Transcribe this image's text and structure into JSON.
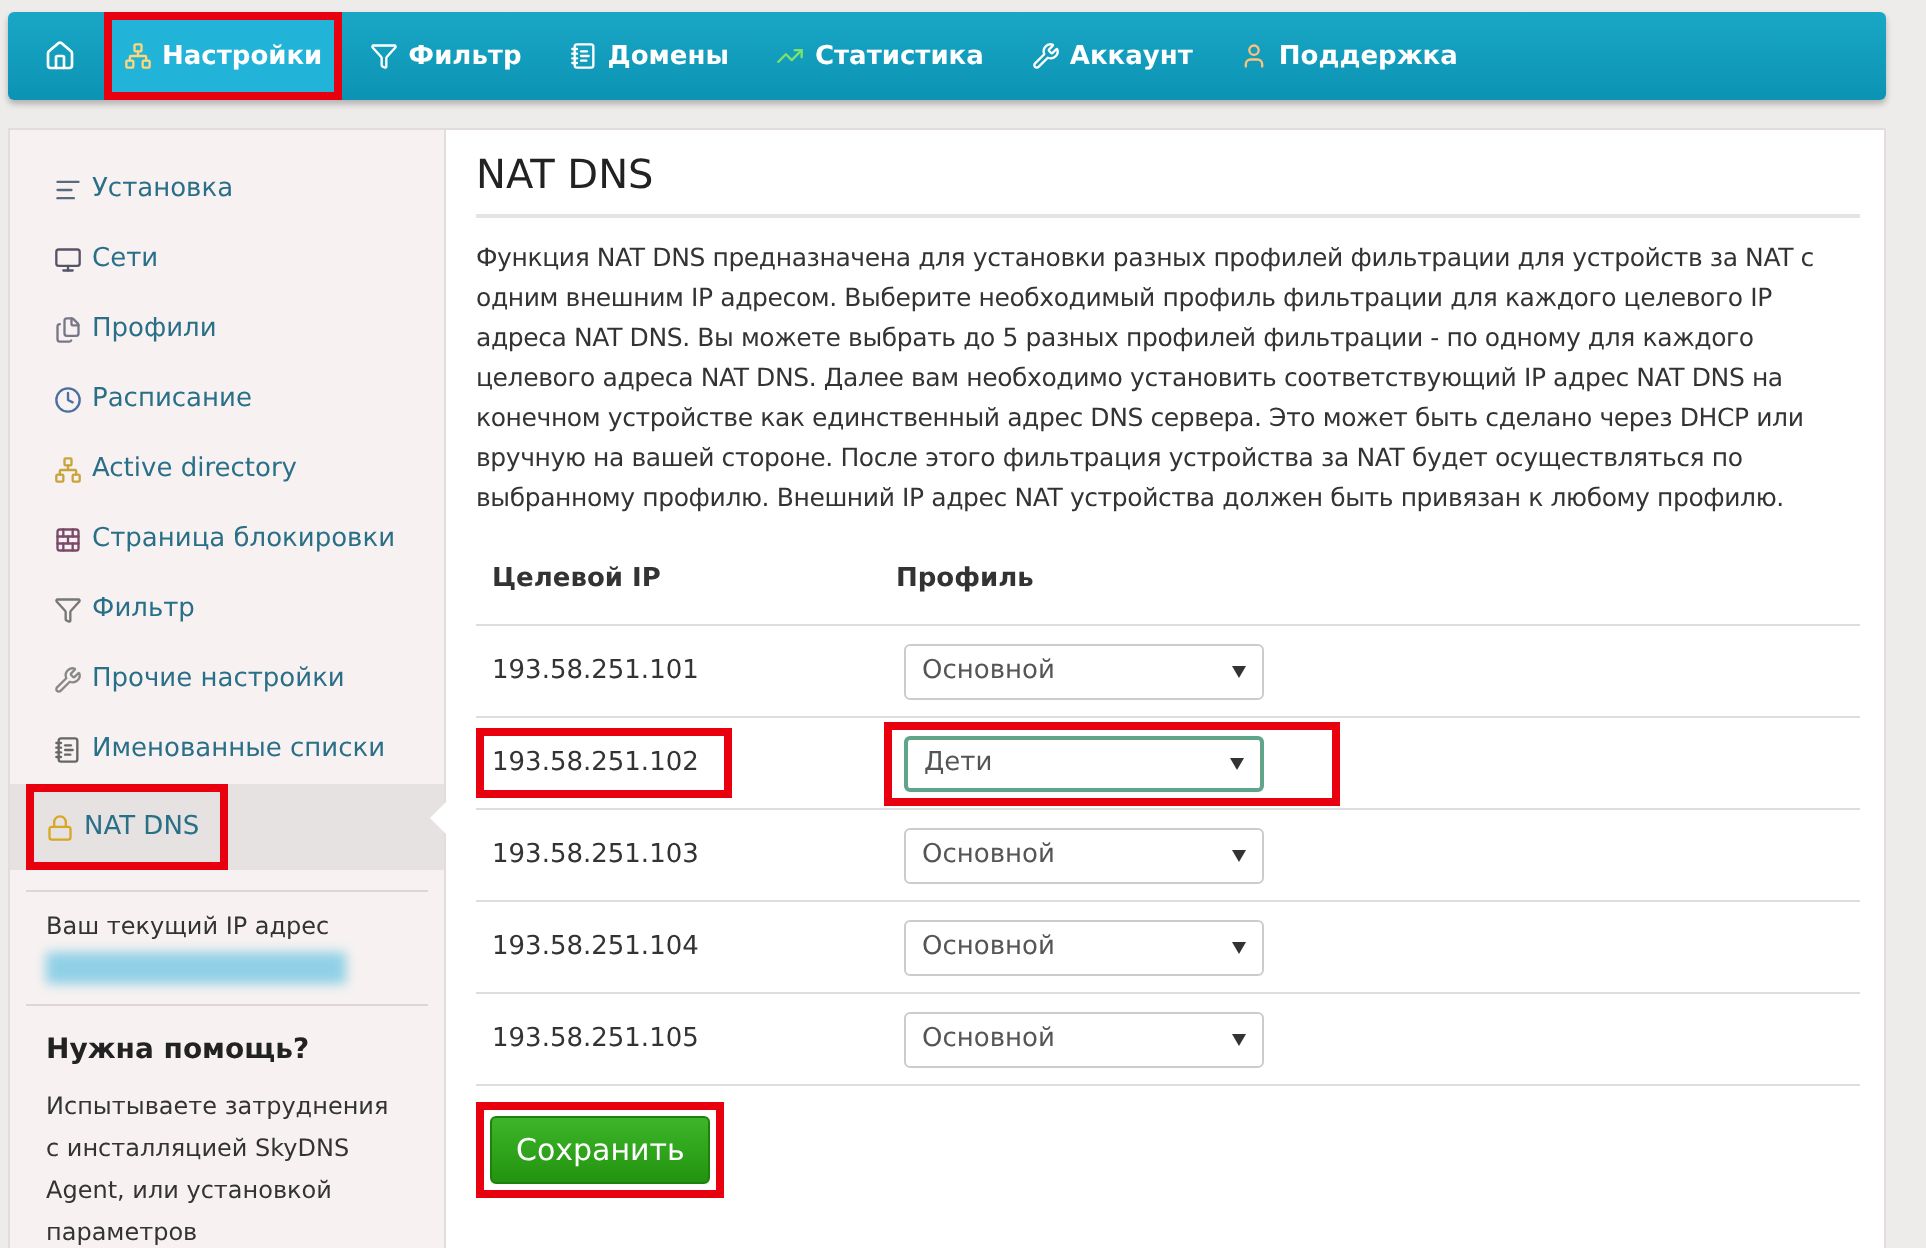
{
  "nav": {
    "items": [
      {
        "label": "Настройки",
        "selected": true,
        "highlighted": true
      },
      {
        "label": "Фильтр",
        "selected": false,
        "highlighted": false
      },
      {
        "label": "Домены",
        "selected": false,
        "highlighted": false
      },
      {
        "label": "Статистика",
        "selected": false,
        "highlighted": false
      },
      {
        "label": "Аккаунт",
        "selected": false,
        "highlighted": false
      },
      {
        "label": "Поддержка",
        "selected": false,
        "highlighted": false
      }
    ]
  },
  "sidebar": {
    "items": [
      {
        "label": "Установка",
        "selected": false,
        "highlighted": false
      },
      {
        "label": "Сети",
        "selected": false,
        "highlighted": false
      },
      {
        "label": "Профили",
        "selected": false,
        "highlighted": false
      },
      {
        "label": "Расписание",
        "selected": false,
        "highlighted": false
      },
      {
        "label": "Active directory",
        "selected": false,
        "highlighted": false
      },
      {
        "label": "Страница блокировки",
        "selected": false,
        "highlighted": false
      },
      {
        "label": "Фильтр",
        "selected": false,
        "highlighted": false
      },
      {
        "label": "Прочие настройки",
        "selected": false,
        "highlighted": false
      },
      {
        "label": "Именованные списки",
        "selected": false,
        "highlighted": false
      },
      {
        "label": "NAT DNS",
        "selected": true,
        "highlighted": true
      }
    ],
    "ip_label": "Ваш текущий IP адрес",
    "help_title": "Нужна помощь?",
    "help_text": "Испытываете затруднения с инсталляцией SkyDNS Agent, или установкой параметров"
  },
  "content": {
    "title": "NAT DNS",
    "description": "Функция NAT DNS предназначена для установки разных профилей фильтрации для устройств за NAT с одним внешним IP адресом. Выберите необходимый профиль фильтрации для каждого целевого IP адреса NAT DNS. Вы можете выбрать до 5 разных профилей фильтрации - по одному для каждого целевого адреса NAT DNS. Далее вам необходимо установить соответствующий IP адрес NAT DNS на конечном устройстве как единственный адрес DNS сервера. Это может быть сделано через DHCP или вручную на вашей стороне. После этого фильтрация устройства за NAT будет осуществляться по выбранному профилю. Внешний IP адрес NAT устройства должен быть привязан к любому профилю.",
    "table": {
      "columns": [
        "Целевой IP",
        "Профиль"
      ],
      "rows": [
        {
          "ip": "193.58.251.101",
          "profile": "Основной",
          "focused": false,
          "highlighted": false
        },
        {
          "ip": "193.58.251.102",
          "profile": "Дети",
          "focused": true,
          "highlighted": true
        },
        {
          "ip": "193.58.251.103",
          "profile": "Основной",
          "focused": false,
          "highlighted": false
        },
        {
          "ip": "193.58.251.104",
          "profile": "Основной",
          "focused": false,
          "highlighted": false
        },
        {
          "ip": "193.58.251.105",
          "profile": "Основной",
          "focused": false,
          "highlighted": false
        }
      ]
    },
    "save_button": {
      "label": "Сохранить",
      "highlighted": true
    }
  }
}
